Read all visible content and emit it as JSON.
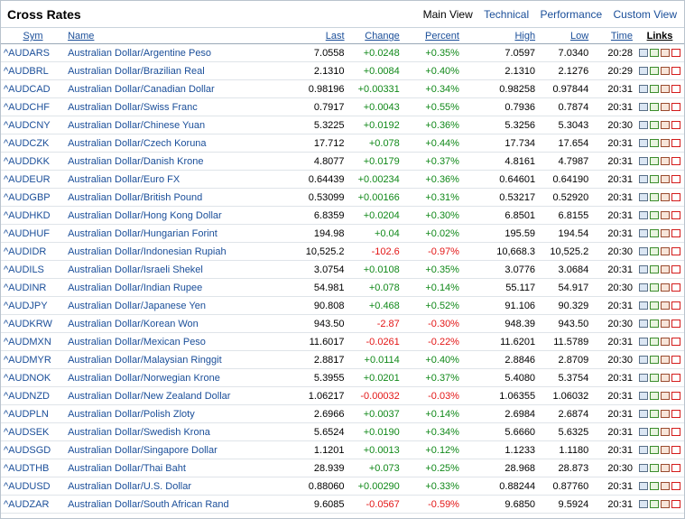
{
  "header": {
    "title": "Cross Rates",
    "views": [
      "Main View",
      "Technical",
      "Performance",
      "Custom View"
    ]
  },
  "columns": [
    "Sym",
    "Name",
    "Last",
    "Change",
    "Percent",
    "High",
    "Low",
    "Time",
    "Links"
  ],
  "rows": [
    {
      "sym": "^AUDARS",
      "name": "Australian Dollar/Argentine Peso",
      "last": "7.0558",
      "change": "+0.0248",
      "percent": "+0.35%",
      "high": "7.0597",
      "low": "7.0340",
      "time": "20:28"
    },
    {
      "sym": "^AUDBRL",
      "name": "Australian Dollar/Brazilian Real",
      "last": "2.1310",
      "change": "+0.0084",
      "percent": "+0.40%",
      "high": "2.1310",
      "low": "2.1276",
      "time": "20:29"
    },
    {
      "sym": "^AUDCAD",
      "name": "Australian Dollar/Canadian Dollar",
      "last": "0.98196",
      "change": "+0.00331",
      "percent": "+0.34%",
      "high": "0.98258",
      "low": "0.97844",
      "time": "20:31"
    },
    {
      "sym": "^AUDCHF",
      "name": "Australian Dollar/Swiss Franc",
      "last": "0.7917",
      "change": "+0.0043",
      "percent": "+0.55%",
      "high": "0.7936",
      "low": "0.7874",
      "time": "20:31"
    },
    {
      "sym": "^AUDCNY",
      "name": "Australian Dollar/Chinese Yuan",
      "last": "5.3225",
      "change": "+0.0192",
      "percent": "+0.36%",
      "high": "5.3256",
      "low": "5.3043",
      "time": "20:30"
    },
    {
      "sym": "^AUDCZK",
      "name": "Australian Dollar/Czech Koruna",
      "last": "17.712",
      "change": "+0.078",
      "percent": "+0.44%",
      "high": "17.734",
      "low": "17.654",
      "time": "20:31"
    },
    {
      "sym": "^AUDDKK",
      "name": "Australian Dollar/Danish Krone",
      "last": "4.8077",
      "change": "+0.0179",
      "percent": "+0.37%",
      "high": "4.8161",
      "low": "4.7987",
      "time": "20:31"
    },
    {
      "sym": "^AUDEUR",
      "name": "Australian Dollar/Euro FX",
      "last": "0.64439",
      "change": "+0.00234",
      "percent": "+0.36%",
      "high": "0.64601",
      "low": "0.64190",
      "time": "20:31"
    },
    {
      "sym": "^AUDGBP",
      "name": "Australian Dollar/British Pound",
      "last": "0.53099",
      "change": "+0.00166",
      "percent": "+0.31%",
      "high": "0.53217",
      "low": "0.52920",
      "time": "20:31"
    },
    {
      "sym": "^AUDHKD",
      "name": "Australian Dollar/Hong Kong Dollar",
      "last": "6.8359",
      "change": "+0.0204",
      "percent": "+0.30%",
      "high": "6.8501",
      "low": "6.8155",
      "time": "20:31"
    },
    {
      "sym": "^AUDHUF",
      "name": "Australian Dollar/Hungarian Forint",
      "last": "194.98",
      "change": "+0.04",
      "percent": "+0.02%",
      "high": "195.59",
      "low": "194.54",
      "time": "20:31"
    },
    {
      "sym": "^AUDIDR",
      "name": "Australian Dollar/Indonesian Rupiah",
      "last": "10,525.2",
      "change": "-102.6",
      "percent": "-0.97%",
      "high": "10,668.3",
      "low": "10,525.2",
      "time": "20:30"
    },
    {
      "sym": "^AUDILS",
      "name": "Australian Dollar/Israeli Shekel",
      "last": "3.0754",
      "change": "+0.0108",
      "percent": "+0.35%",
      "high": "3.0776",
      "low": "3.0684",
      "time": "20:31"
    },
    {
      "sym": "^AUDINR",
      "name": "Australian Dollar/Indian Rupee",
      "last": "54.981",
      "change": "+0.078",
      "percent": "+0.14%",
      "high": "55.117",
      "low": "54.917",
      "time": "20:30"
    },
    {
      "sym": "^AUDJPY",
      "name": "Australian Dollar/Japanese Yen",
      "last": "90.808",
      "change": "+0.468",
      "percent": "+0.52%",
      "high": "91.106",
      "low": "90.329",
      "time": "20:31"
    },
    {
      "sym": "^AUDKRW",
      "name": "Australian Dollar/Korean Won",
      "last": "943.50",
      "change": "-2.87",
      "percent": "-0.30%",
      "high": "948.39",
      "low": "943.50",
      "time": "20:30"
    },
    {
      "sym": "^AUDMXN",
      "name": "Australian Dollar/Mexican Peso",
      "last": "11.6017",
      "change": "-0.0261",
      "percent": "-0.22%",
      "high": "11.6201",
      "low": "11.5789",
      "time": "20:31"
    },
    {
      "sym": "^AUDMYR",
      "name": "Australian Dollar/Malaysian Ringgit",
      "last": "2.8817",
      "change": "+0.0114",
      "percent": "+0.40%",
      "high": "2.8846",
      "low": "2.8709",
      "time": "20:30"
    },
    {
      "sym": "^AUDNOK",
      "name": "Australian Dollar/Norwegian Krone",
      "last": "5.3955",
      "change": "+0.0201",
      "percent": "+0.37%",
      "high": "5.4080",
      "low": "5.3754",
      "time": "20:31"
    },
    {
      "sym": "^AUDNZD",
      "name": "Australian Dollar/New Zealand Dollar",
      "last": "1.06217",
      "change": "-0.00032",
      "percent": "-0.03%",
      "high": "1.06355",
      "low": "1.06032",
      "time": "20:31"
    },
    {
      "sym": "^AUDPLN",
      "name": "Australian Dollar/Polish Zloty",
      "last": "2.6966",
      "change": "+0.0037",
      "percent": "+0.14%",
      "high": "2.6984",
      "low": "2.6874",
      "time": "20:31"
    },
    {
      "sym": "^AUDSEK",
      "name": "Australian Dollar/Swedish Krona",
      "last": "5.6524",
      "change": "+0.0190",
      "percent": "+0.34%",
      "high": "5.6660",
      "low": "5.6325",
      "time": "20:31"
    },
    {
      "sym": "^AUDSGD",
      "name": "Australian Dollar/Singapore Dollar",
      "last": "1.1201",
      "change": "+0.0013",
      "percent": "+0.12%",
      "high": "1.1233",
      "low": "1.1180",
      "time": "20:31"
    },
    {
      "sym": "^AUDTHB",
      "name": "Australian Dollar/Thai Baht",
      "last": "28.939",
      "change": "+0.073",
      "percent": "+0.25%",
      "high": "28.968",
      "low": "28.873",
      "time": "20:30"
    },
    {
      "sym": "^AUDUSD",
      "name": "Australian Dollar/U.S. Dollar",
      "last": "0.88060",
      "change": "+0.00290",
      "percent": "+0.33%",
      "high": "0.88244",
      "low": "0.87760",
      "time": "20:31"
    },
    {
      "sym": "^AUDZAR",
      "name": "Australian Dollar/South African Rand",
      "last": "9.6085",
      "change": "-0.0567",
      "percent": "-0.59%",
      "high": "9.6850",
      "low": "9.5924",
      "time": "20:31"
    }
  ],
  "links_icons": [
    "news-icon",
    "chart-icon",
    "options-icon",
    "alert-icon"
  ],
  "colors": {
    "positive": "#11891a",
    "negative": "#e31717",
    "link": "#1a4e99"
  }
}
